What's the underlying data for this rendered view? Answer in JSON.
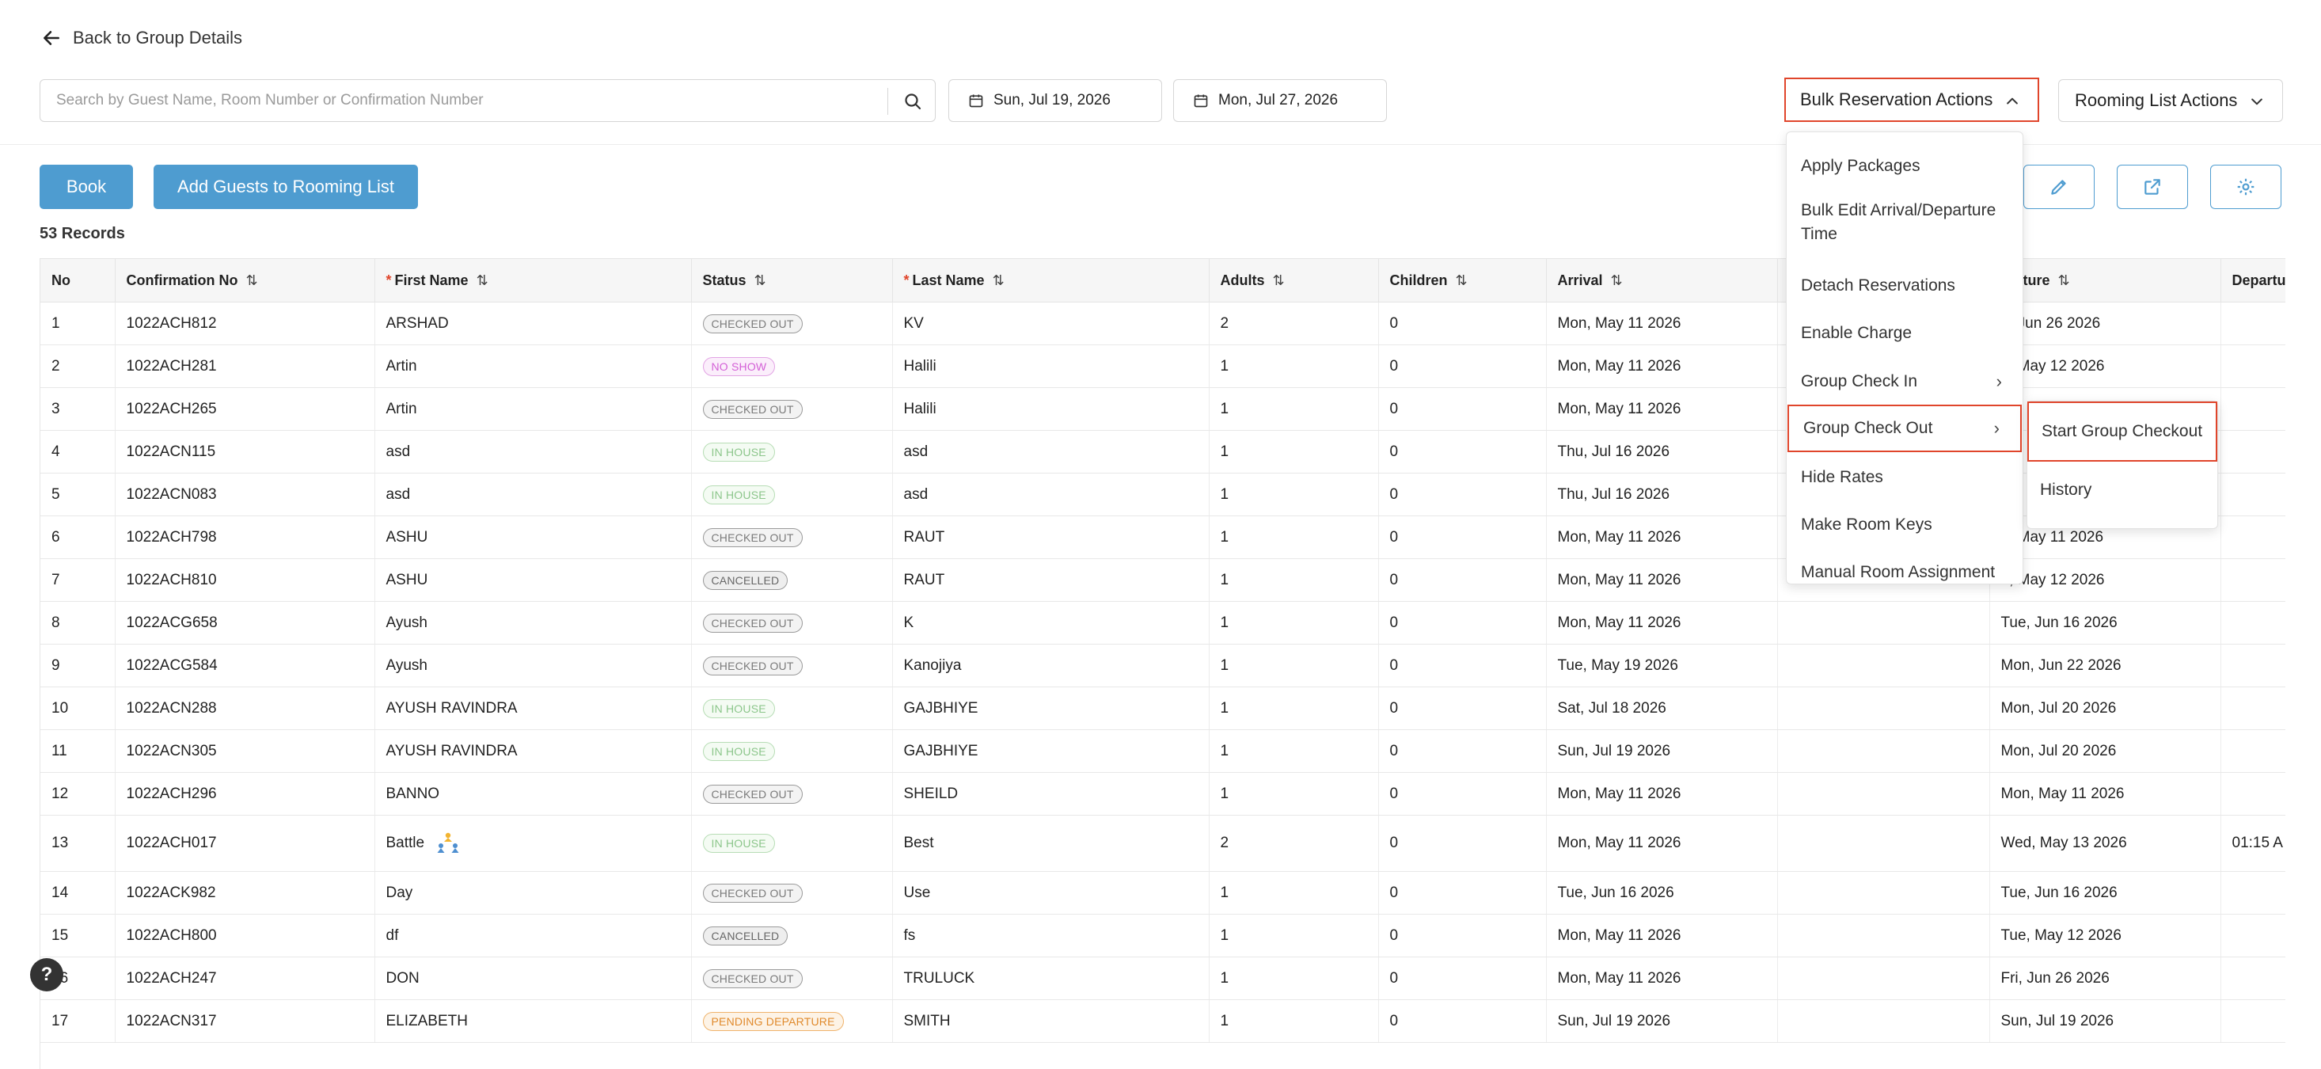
{
  "nav": {
    "back_label": "Back to Group Details"
  },
  "search": {
    "placeholder": "Search by Guest Name, Room Number or Confirmation Number",
    "value": ""
  },
  "dates": {
    "start": "Sun, Jul 19, 2026",
    "end": "Mon, Jul 27, 2026"
  },
  "actions": {
    "bulk_label": "Bulk Reservation Actions",
    "rooming_label": "Rooming List Actions"
  },
  "toolbar": {
    "book_label": "Book",
    "add_guests_label": "Add Guests to Rooming List"
  },
  "records_label": "53 Records",
  "table": {
    "columns": {
      "no": "No",
      "confirmation": "Confirmation No",
      "first_name": "First Name",
      "status": "Status",
      "last_name": "Last Name",
      "adults": "Adults",
      "children": "Children",
      "arrival": "Arrival",
      "departure": "parture",
      "departure_time": "Departu"
    },
    "rows": [
      {
        "no": "1",
        "conf": "1022ACH812",
        "first": "ARSHAD",
        "status": "CHECKED OUT",
        "kind": "out",
        "last": "KV",
        "adults": "2",
        "children": "0",
        "arrival": "Mon, May 11 2026",
        "departure": "n, Jun 26 2026",
        "dtime": ""
      },
      {
        "no": "2",
        "conf": "1022ACH281",
        "first": "Artin",
        "status": "NO SHOW",
        "kind": "noshow",
        "last": "Halili",
        "adults": "1",
        "children": "0",
        "arrival": "Mon, May 11 2026",
        "departure": "e, May 12 2026",
        "dtime": ""
      },
      {
        "no": "3",
        "conf": "1022ACH265",
        "first": "Artin",
        "status": "CHECKED OUT",
        "kind": "out",
        "last": "Halili",
        "adults": "1",
        "children": "0",
        "arrival": "Mon, May 11 2026",
        "departure": "",
        "dtime": ""
      },
      {
        "no": "4",
        "conf": "1022ACN115",
        "first": "asd",
        "status": "IN HOUSE",
        "kind": "inhouse",
        "last": "asd",
        "adults": "1",
        "children": "0",
        "arrival": "Thu, Jul 16 2026",
        "departure": "",
        "dtime": ""
      },
      {
        "no": "5",
        "conf": "1022ACN083",
        "first": "asd",
        "status": "IN HOUSE",
        "kind": "inhouse",
        "last": "asd",
        "adults": "1",
        "children": "0",
        "arrival": "Thu, Jul 16 2026",
        "departure": "",
        "dtime": ""
      },
      {
        "no": "6",
        "conf": "1022ACH798",
        "first": "ASHU",
        "status": "CHECKED OUT",
        "kind": "out",
        "last": "RAUT",
        "adults": "1",
        "children": "0",
        "arrival": "Mon, May 11 2026",
        "departure": "n, May 11 2026",
        "dtime": ""
      },
      {
        "no": "7",
        "conf": "1022ACH810",
        "first": "ASHU",
        "status": "CANCELLED",
        "kind": "cancel",
        "last": "RAUT",
        "adults": "1",
        "children": "0",
        "arrival": "Mon, May 11 2026",
        "departure": "e, May 12 2026",
        "dtime": ""
      },
      {
        "no": "8",
        "conf": "1022ACG658",
        "first": "Ayush",
        "status": "CHECKED OUT",
        "kind": "out",
        "last": "K",
        "adults": "1",
        "children": "0",
        "arrival": "Mon, May 11 2026",
        "departure": "Tue, Jun 16 2026",
        "dtime": ""
      },
      {
        "no": "9",
        "conf": "1022ACG584",
        "first": "Ayush",
        "status": "CHECKED OUT",
        "kind": "out",
        "last": "Kanojiya",
        "adults": "1",
        "children": "0",
        "arrival": "Tue, May 19 2026",
        "departure": "Mon, Jun 22 2026",
        "dtime": ""
      },
      {
        "no": "10",
        "conf": "1022ACN288",
        "first": "AYUSH RAVINDRA",
        "status": "IN HOUSE",
        "kind": "inhouse",
        "last": "GAJBHIYE",
        "adults": "1",
        "children": "0",
        "arrival": "Sat, Jul 18 2026",
        "departure": "Mon, Jul 20 2026",
        "dtime": ""
      },
      {
        "no": "11",
        "conf": "1022ACN305",
        "first": "AYUSH RAVINDRA",
        "status": "IN HOUSE",
        "kind": "inhouse",
        "last": "GAJBHIYE",
        "adults": "1",
        "children": "0",
        "arrival": "Sun, Jul 19 2026",
        "departure": "Mon, Jul 20 2026",
        "dtime": ""
      },
      {
        "no": "12",
        "conf": "1022ACH296",
        "first": "BANNO",
        "status": "CHECKED OUT",
        "kind": "out",
        "last": "SHEILD",
        "adults": "1",
        "children": "0",
        "arrival": "Mon, May 11 2026",
        "departure": "Mon, May 11 2026",
        "dtime": ""
      },
      {
        "no": "13",
        "conf": "1022ACH017",
        "first": "Battle",
        "status": "IN HOUSE",
        "kind": "inhouse",
        "last": "Best",
        "adults": "2",
        "children": "0",
        "arrival": "Mon, May 11 2026",
        "departure": "Wed, May 13 2026",
        "dtime": "01:15 A",
        "tall": true,
        "group": true
      },
      {
        "no": "14",
        "conf": "1022ACK982",
        "first": "Day",
        "status": "CHECKED OUT",
        "kind": "out",
        "last": "Use",
        "adults": "1",
        "children": "0",
        "arrival": "Tue, Jun 16 2026",
        "departure": "Tue, Jun 16 2026",
        "dtime": ""
      },
      {
        "no": "15",
        "conf": "1022ACH800",
        "first": "df",
        "status": "CANCELLED",
        "kind": "cancel",
        "last": "fs",
        "adults": "1",
        "children": "0",
        "arrival": "Mon, May 11 2026",
        "departure": "Tue, May 12 2026",
        "dtime": ""
      },
      {
        "no": "16",
        "conf": "1022ACH247",
        "first": "DON",
        "status": "CHECKED OUT",
        "kind": "out",
        "last": "TRULUCK",
        "adults": "1",
        "children": "0",
        "arrival": "Mon, May 11 2026",
        "departure": "Fri, Jun 26 2026",
        "dtime": ""
      },
      {
        "no": "17",
        "conf": "1022ACN317",
        "first": "ELIZABETH",
        "status": "PENDING DEPARTURE",
        "kind": "pending",
        "last": "SMITH",
        "adults": "1",
        "children": "0",
        "arrival": "Sun, Jul 19 2026",
        "departure": "Sun, Jul 19 2026",
        "dtime": ""
      }
    ]
  },
  "bulk_menu": {
    "items": [
      {
        "label": "Apply Packages",
        "has_submenu": false,
        "highlighted": false
      },
      {
        "label": "Bulk Edit Arrival/Departure Time",
        "has_submenu": false,
        "highlighted": false
      },
      {
        "label": "Detach Reservations",
        "has_submenu": false,
        "highlighted": false
      },
      {
        "label": "Enable Charge",
        "has_submenu": false,
        "highlighted": false
      },
      {
        "label": "Group Check In",
        "has_submenu": true,
        "highlighted": false
      },
      {
        "label": "Group Check Out",
        "has_submenu": true,
        "highlighted": true
      },
      {
        "label": "Hide Rates",
        "has_submenu": false,
        "highlighted": false
      },
      {
        "label": "Make Room Keys",
        "has_submenu": false,
        "highlighted": false
      },
      {
        "label": "Manual Room Assignment",
        "has_submenu": false,
        "highlighted": false
      }
    ]
  },
  "checkout_submenu": {
    "items": [
      {
        "label": "Start Group Checkout",
        "highlighted": true
      },
      {
        "label": "History",
        "highlighted": false
      }
    ]
  },
  "help": {
    "label": "?"
  },
  "colors": {
    "accent": "#4e9cd0",
    "highlight": "#e0452b",
    "required": "#e0452b"
  }
}
